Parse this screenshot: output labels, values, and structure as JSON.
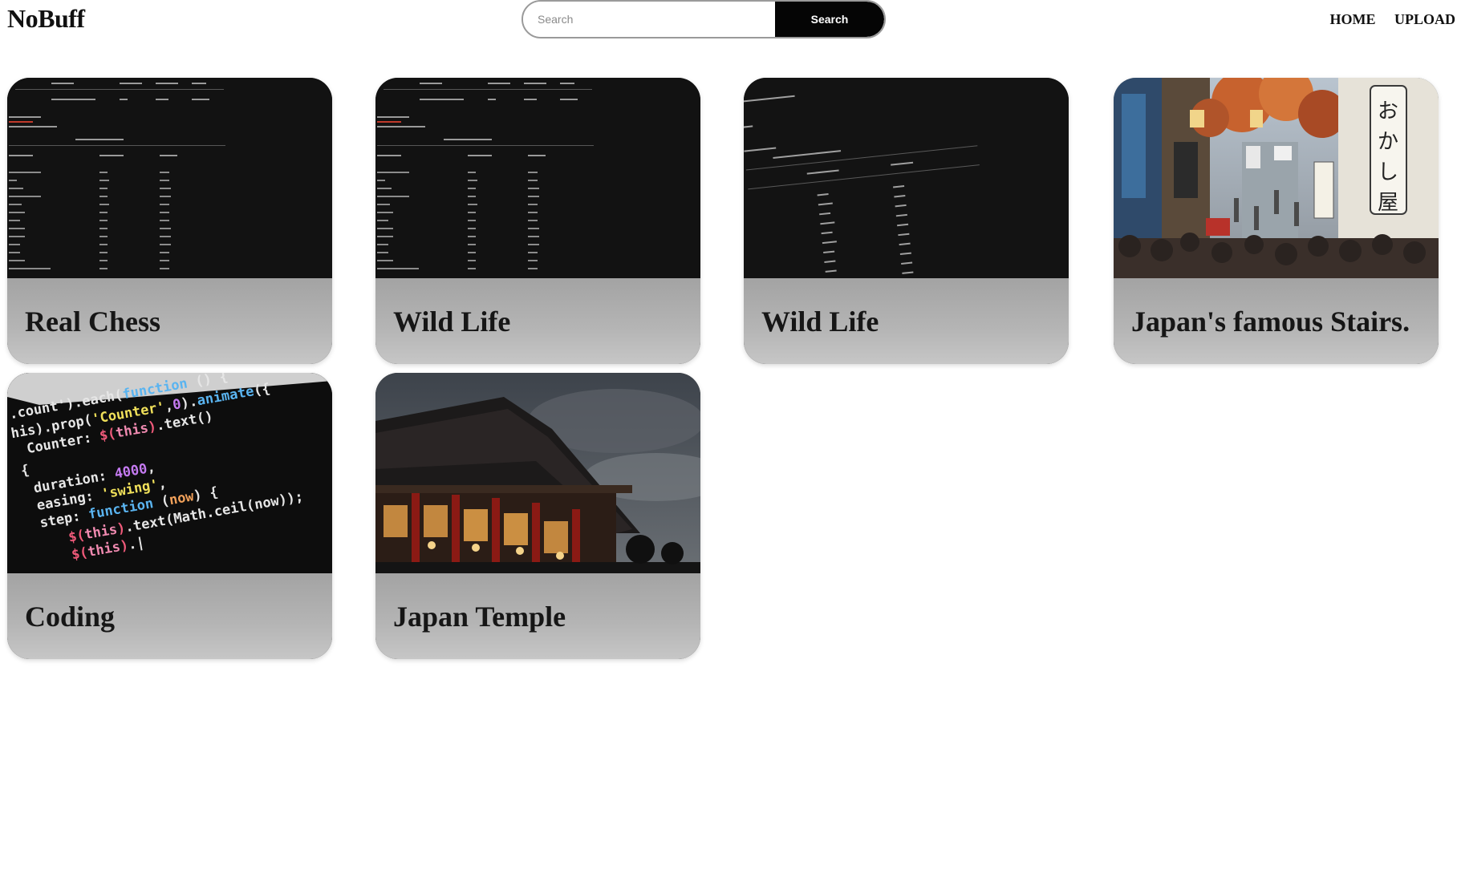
{
  "header": {
    "logo": "NoBuff",
    "search": {
      "placeholder": "Search",
      "value": "",
      "button_label": "Search"
    },
    "nav": [
      {
        "label": "HOME"
      },
      {
        "label": "UPLOAD"
      }
    ]
  },
  "cards": [
    {
      "title": "Real Chess",
      "image": "terminal-wifi-list"
    },
    {
      "title": "Wild Life",
      "image": "terminal-wifi-list"
    },
    {
      "title": "Wild Life",
      "image": "terminal-wifi-list-angled"
    },
    {
      "title": "Japan's famous Stairs.",
      "image": "japan-street-stairs-photo"
    },
    {
      "title": "Coding",
      "image": "code-editor-photo"
    },
    {
      "title": "Japan Temple",
      "image": "japan-temple-photo"
    }
  ],
  "colors": {
    "search_button": "#050505",
    "caption_bg": "#a8a8a8",
    "page_bg": "#ffffff"
  }
}
